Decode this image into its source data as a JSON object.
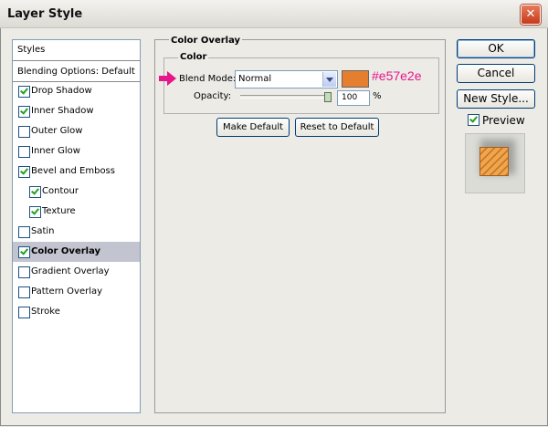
{
  "window": {
    "title": "Layer Style",
    "close_glyph": "✕"
  },
  "left_panel": {
    "header": "Styles",
    "blending_options": "Blending Options: Default",
    "items": [
      {
        "label": "Drop Shadow",
        "checked": true,
        "indent": false,
        "selected": false
      },
      {
        "label": "Inner Shadow",
        "checked": true,
        "indent": false,
        "selected": false
      },
      {
        "label": "Outer Glow",
        "checked": false,
        "indent": false,
        "selected": false
      },
      {
        "label": "Inner Glow",
        "checked": false,
        "indent": false,
        "selected": false
      },
      {
        "label": "Bevel and Emboss",
        "checked": true,
        "indent": false,
        "selected": false
      },
      {
        "label": "Contour",
        "checked": true,
        "indent": true,
        "selected": false
      },
      {
        "label": "Texture",
        "checked": true,
        "indent": true,
        "selected": false
      },
      {
        "label": "Satin",
        "checked": false,
        "indent": false,
        "selected": false
      },
      {
        "label": "Color Overlay",
        "checked": true,
        "indent": false,
        "selected": true
      },
      {
        "label": "Gradient Overlay",
        "checked": false,
        "indent": false,
        "selected": false
      },
      {
        "label": "Pattern Overlay",
        "checked": false,
        "indent": false,
        "selected": false
      },
      {
        "label": "Stroke",
        "checked": false,
        "indent": false,
        "selected": false
      }
    ]
  },
  "main": {
    "section_title": "Color Overlay",
    "group_title": "Color",
    "blend_mode_label": "Blend Mode:",
    "blend_mode_value": "Normal",
    "swatch_color": "#e57e2e",
    "hex_annotation": "#e57e2e",
    "opacity_label": "Opacity:",
    "opacity_value": "100",
    "opacity_unit": "%",
    "make_default": "Make Default",
    "reset_default": "Reset to Default"
  },
  "right": {
    "ok": "OK",
    "cancel": "Cancel",
    "new_style": "New Style...",
    "preview_label": "Preview",
    "preview_checked": true
  },
  "colors": {
    "accent": "#e6168b",
    "selection": "#c2c4d0"
  }
}
